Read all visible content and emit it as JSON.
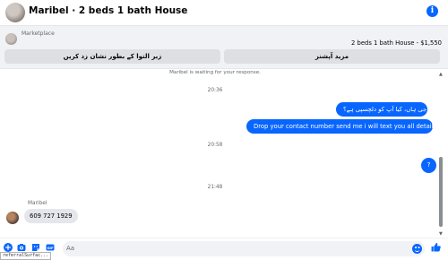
{
  "header": {
    "title": "Maribel · 2 beds 1 bath House",
    "info_icon": "info-icon",
    "accent": "#0866ff"
  },
  "marketplace": {
    "label": "Marketplace",
    "listing": "2 beds 1 bath House - $1,550",
    "button_left": "زبر التوا کے بطور نشان زد کریں",
    "button_right": "مزید آپشنز"
  },
  "conversation": {
    "system_note": "Maribel is waiting for your response.",
    "timestamps": [
      "20:36",
      "20:58",
      "21:48"
    ],
    "outgoing": [
      "جی ہاں، کیا آپ کو دلچسپی ہے؟",
      "Drop your contact number send me i will text you all details",
      "?"
    ],
    "sender_name": "Maribel",
    "incoming": [
      "609 727 1929"
    ]
  },
  "composer": {
    "placeholder": "Aa",
    "icons": [
      "plus-circle-icon",
      "camera-icon",
      "sticker-icon",
      "gif-icon",
      "emoji-icon",
      "thumbs-up-icon"
    ],
    "gif_label": "GIF"
  },
  "overlay": {
    "referral": "referralSurfac..."
  }
}
